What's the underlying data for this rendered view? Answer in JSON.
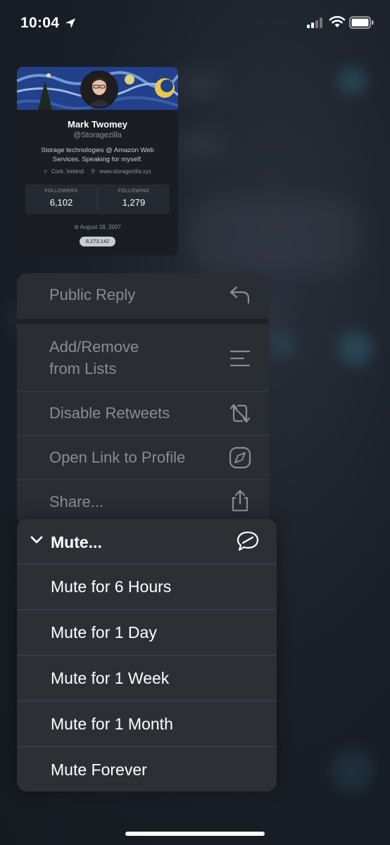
{
  "status": {
    "time": "10:04"
  },
  "profile": {
    "name": "Mark Twomey",
    "handle": "@Storagezilla",
    "bio": "Storage technologies @ Amazon Web Services. Speaking for myself.",
    "location": "Cork, Ireland.",
    "website": "www.storagezilla.xyz",
    "followers_label": "FOLLOWERS",
    "followers": "6,102",
    "following_label": "FOLLOWING",
    "following": "1,279",
    "joined": "August 18, 2007",
    "id_badge": "8,273,142"
  },
  "menu": {
    "items": [
      {
        "label": "Public Reply",
        "icon": "reply-icon"
      },
      {
        "label": "Add/Remove",
        "label2": "from Lists",
        "icon": "list-icon"
      },
      {
        "label": "Disable Retweets",
        "icon": "retweet-off-icon"
      },
      {
        "label": "Open Link to Profile",
        "icon": "compass-icon"
      },
      {
        "label": "Share...",
        "icon": "share-icon"
      }
    ]
  },
  "mute_menu": {
    "title": "Mute...",
    "icon": "speech-bubble-slash-icon",
    "options": [
      "Mute for 6 Hours",
      "Mute for 1 Day",
      "Mute for 1 Week",
      "Mute for 1 Month",
      "Mute Forever"
    ]
  }
}
